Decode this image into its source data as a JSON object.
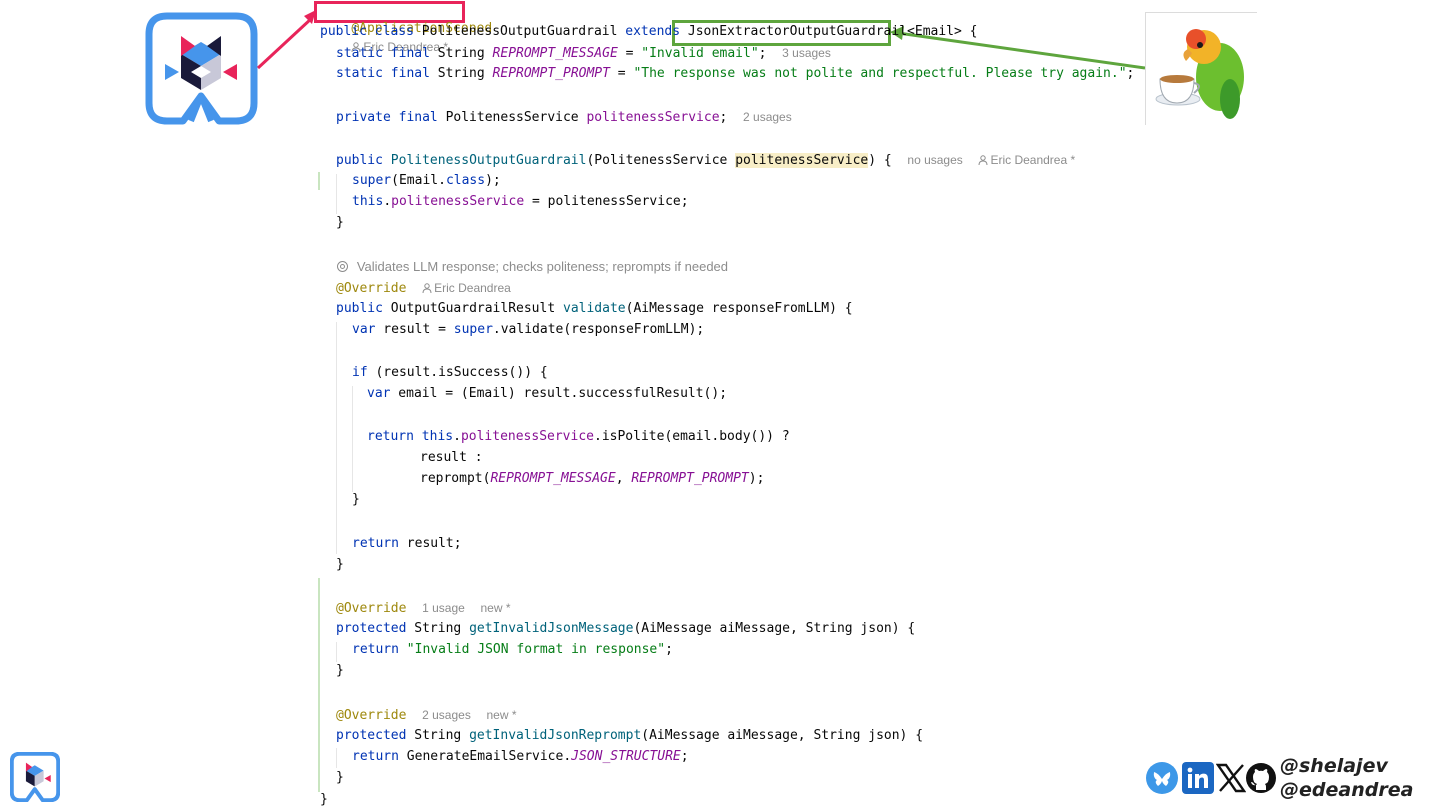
{
  "code": {
    "annotation_app_scoped": "@ApplicationScoped",
    "author_1": "Eric Deandrea *",
    "kw_public": "public",
    "kw_class": "class",
    "class_name": "PolitenessOutputGuardrail",
    "kw_extends": "extends",
    "superclass": "JsonExtractorOutputGuardrail",
    "generic_suffix": "<Email> {",
    "kw_static_final": "static final",
    "type_string": "String",
    "const_msg": "REPROMPT_MESSAGE",
    "eq": " = ",
    "str_invalid_email": "\"Invalid email\"",
    "semi": ";",
    "usages_3": "3 usages",
    "const_prompt": "REPROMPT_PROMPT",
    "str_polite": "\"The response was not polite and respectful. Please try again.\"",
    "kw_private_final": "private final",
    "type_service": "PolitenessService",
    "field_service": "politenessService",
    "usages_2": "2 usages",
    "ctor_name": "PolitenessOutputGuardrail",
    "ctor_open": "(",
    "param_service": "politenessService",
    "ctor_close": ") {",
    "no_usages": "no usages",
    "author_2": "Eric Deandrea *",
    "kw_super": "super",
    "super_call": "(Email.",
    "kw_class2": "class",
    "super_end": ");",
    "kw_this": "this",
    "this_assign": " = politenessService;",
    "brace_close": "}",
    "doc_comment": "Validates LLM response; checks politeness; reprompts if needed",
    "ann_override": "@Override",
    "author_3": "Eric Deandrea",
    "type_result": "OutputGuardrailResult",
    "method_validate": "validate",
    "validate_params": "(AiMessage responseFromLLM) {",
    "kw_var": "var",
    "result_assign": " result = ",
    "validate_call": ".validate(responseFromLLM);",
    "kw_if": "if",
    "if_cond": " (result.isSuccess()) {",
    "email_assign": " email = (Email) result.successfulResult();",
    "kw_return": "return",
    "is_polite_call": ".isPolite(email.body()) ?",
    "result_colon": "result :",
    "reprompt_open": "reprompt(",
    "comma": ", ",
    "reprompt_close": ");",
    "return_result": " result;",
    "usage_1": "1 usage",
    "new_marker": "new *",
    "kw_protected": "protected",
    "method_invalid_msg": "getInvalidJsonMessage",
    "invalid_params": "(AiMessage aiMessage, String json) {",
    "str_invalid_json": "\"Invalid JSON format in response\"",
    "usages_2b": "2 usages",
    "new_marker_2": "new *",
    "method_invalid_reprompt": "getInvalidJsonReprompt",
    "return_generate": " GenerateEmailService.",
    "const_json_structure": "JSON_STRUCTURE",
    "final_brace": "}"
  },
  "footer": {
    "handle_1": "@shelajev",
    "handle_2": "@edeandrea"
  },
  "icons": {
    "logo": "quarkus-logo-icon",
    "avatar": "parrot-with-teacup-icon",
    "bluesky": "bluesky-icon",
    "linkedin": "linkedin-icon",
    "x": "x-icon",
    "github": "github-icon"
  },
  "colors": {
    "highlight_red": "#e8245a",
    "highlight_green": "#5ea53d",
    "quarkus_blue": "#4695eb",
    "keyword": "#0033b3",
    "string": "#067d17",
    "annotation": "#9e880d"
  }
}
